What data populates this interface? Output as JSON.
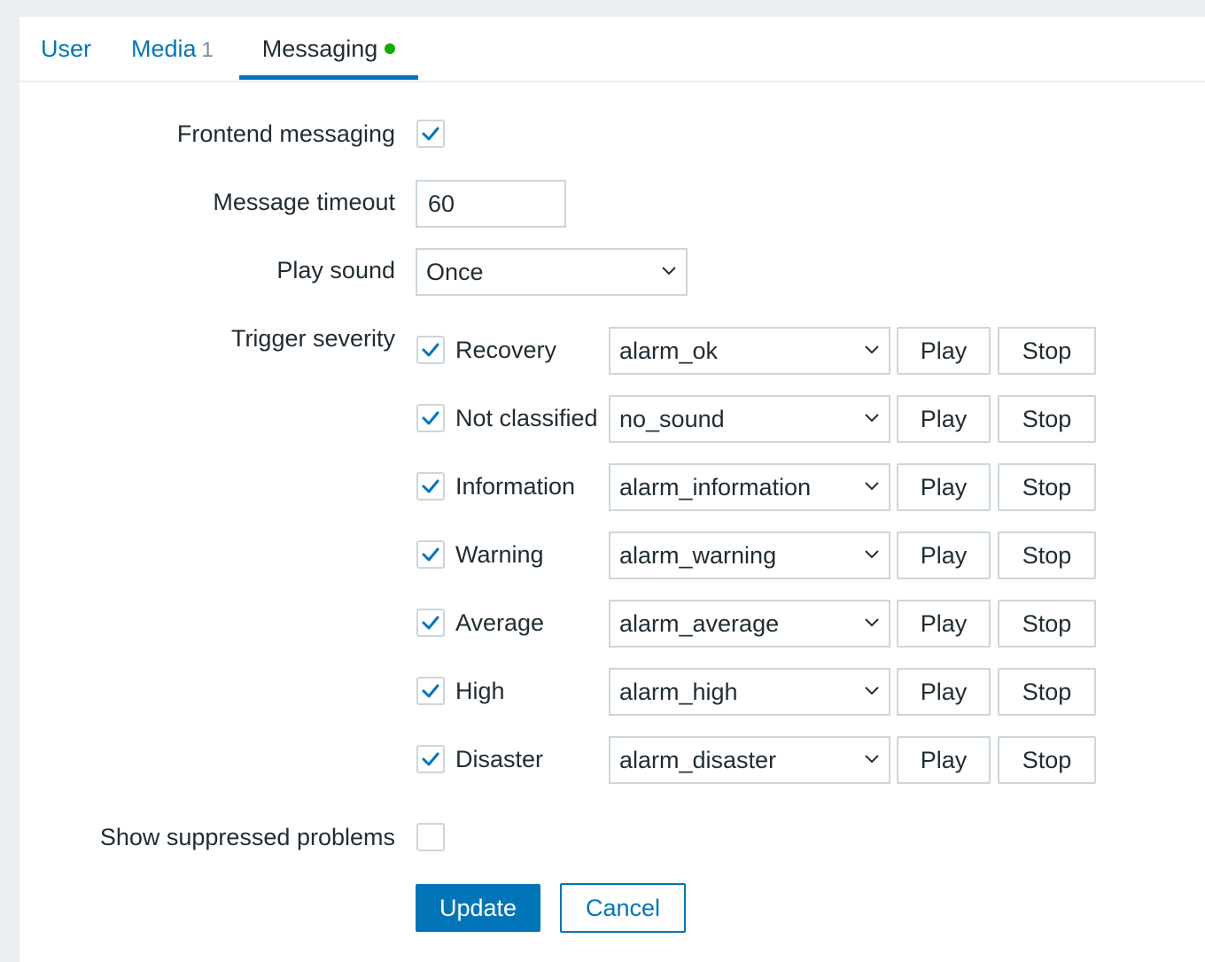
{
  "tabs": {
    "user": "User",
    "media": "Media",
    "media_count": "1",
    "messaging": "Messaging"
  },
  "form": {
    "frontend_messaging_label": "Frontend messaging",
    "frontend_messaging_checked": true,
    "message_timeout_label": "Message timeout",
    "message_timeout_value": "60",
    "play_sound_label": "Play sound",
    "play_sound_value": "Once",
    "trigger_severity_label": "Trigger severity",
    "severities": [
      {
        "label": "Recovery",
        "checked": true,
        "sound": "alarm_ok"
      },
      {
        "label": "Not classified",
        "checked": true,
        "sound": "no_sound"
      },
      {
        "label": "Information",
        "checked": true,
        "sound": "alarm_information"
      },
      {
        "label": "Warning",
        "checked": true,
        "sound": "alarm_warning"
      },
      {
        "label": "Average",
        "checked": true,
        "sound": "alarm_average"
      },
      {
        "label": "High",
        "checked": true,
        "sound": "alarm_high"
      },
      {
        "label": "Disaster",
        "checked": true,
        "sound": "alarm_disaster"
      }
    ],
    "play_label": "Play",
    "stop_label": "Stop",
    "show_suppressed_label": "Show suppressed problems",
    "show_suppressed_checked": false
  },
  "buttons": {
    "update": "Update",
    "cancel": "Cancel"
  },
  "colors": {
    "accent": "#0275b8",
    "status_dot": "#0eac00",
    "border": "#cbd6dc"
  }
}
